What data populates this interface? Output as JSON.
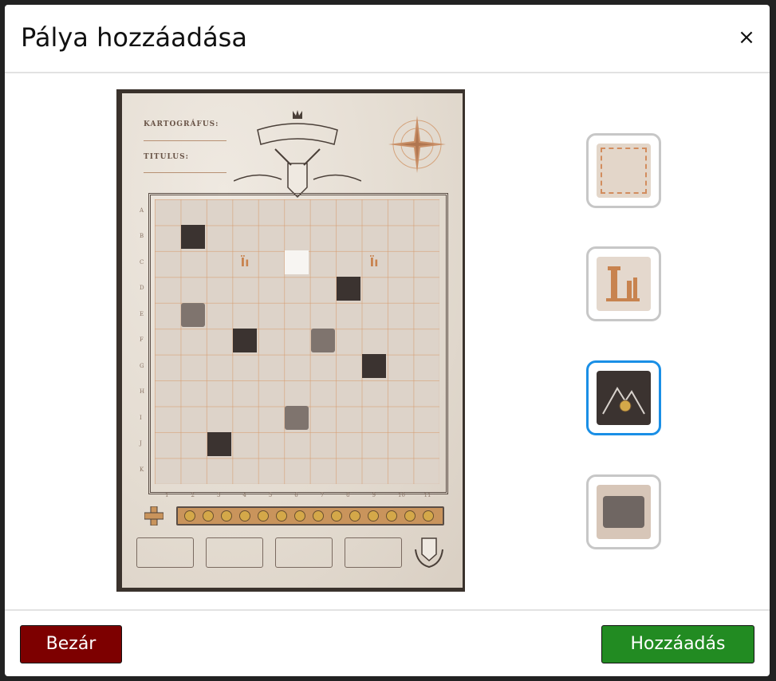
{
  "dialog": {
    "title": "Pálya hozzáadása",
    "close_glyph": "×"
  },
  "map": {
    "cartographer_label": "KARTOGRÁFUS:",
    "title_label": "TITULUS:",
    "row_labels": [
      "A",
      "B",
      "C",
      "D",
      "E",
      "F",
      "G",
      "H",
      "I",
      "J",
      "K"
    ],
    "col_labels": [
      "1",
      "2",
      "3",
      "4",
      "5",
      "6",
      "7",
      "8",
      "9",
      "10",
      "11"
    ],
    "ruin_glyph": "Ïı"
  },
  "tiles": [
    {
      "name": "empty",
      "icon": "empty-field-icon",
      "selected": false
    },
    {
      "name": "ruin",
      "icon": "ruin-icon",
      "selected": false
    },
    {
      "name": "mountain",
      "icon": "mountain-icon",
      "selected": true
    },
    {
      "name": "wasteland",
      "icon": "wasteland-icon",
      "selected": false
    }
  ],
  "footer": {
    "close_label": "Bezár",
    "add_label": "Hozzáadás"
  },
  "colors": {
    "close_button": "#7d0000",
    "add_button": "#228b22",
    "selected_border": "#1a8fe6"
  }
}
